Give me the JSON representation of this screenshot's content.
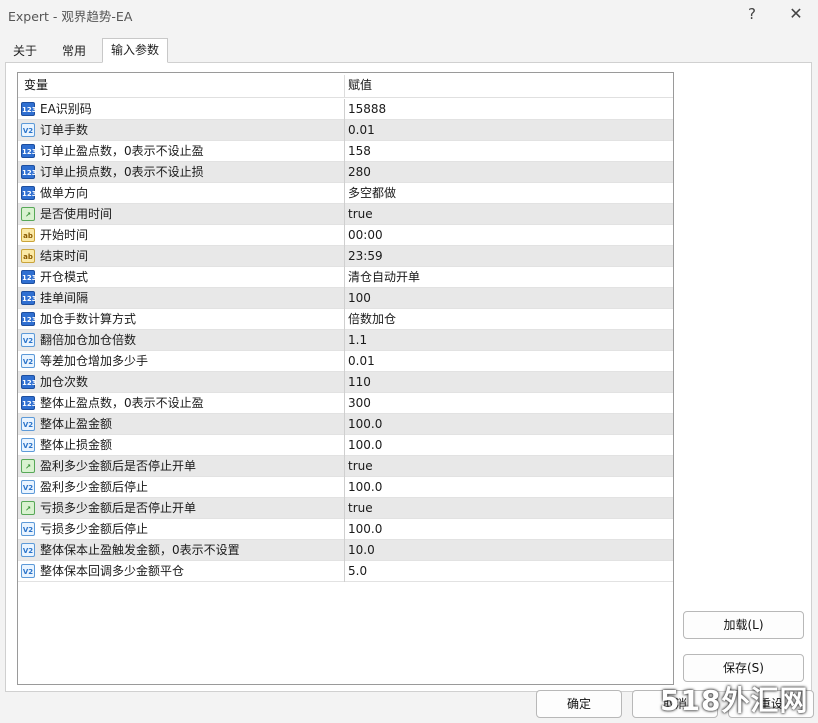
{
  "window": {
    "title": "Expert - 观界趋势-EA",
    "help": "?",
    "close": "✕"
  },
  "tabs": [
    {
      "label": "关于"
    },
    {
      "label": "常用"
    },
    {
      "label": "输入参数",
      "active": true
    }
  ],
  "grid": {
    "columns": [
      "变量",
      "赋值"
    ],
    "rows": [
      {
        "icon": "int-param-icon",
        "name": "EA识别码",
        "value": "15888"
      },
      {
        "icon": "double-param-icon",
        "name": "订单手数",
        "value": "0.01"
      },
      {
        "icon": "int-param-icon",
        "name": "订单止盈点数，0表示不设止盈",
        "value": "158"
      },
      {
        "icon": "int-param-icon",
        "name": "订单止损点数，0表示不设止损",
        "value": "280"
      },
      {
        "icon": "int-param-icon",
        "name": "做单方向",
        "value": "多空都做"
      },
      {
        "icon": "bool-param-icon",
        "name": "是否使用时间",
        "value": "true"
      },
      {
        "icon": "string-param-icon",
        "name": "开始时间",
        "value": "00:00"
      },
      {
        "icon": "string-param-icon",
        "name": "结束时间",
        "value": "23:59"
      },
      {
        "icon": "int-param-icon",
        "name": "开仓模式",
        "value": "清仓自动开单"
      },
      {
        "icon": "int-param-icon",
        "name": "挂单间隔",
        "value": "100"
      },
      {
        "icon": "int-param-icon",
        "name": "加仓手数计算方式",
        "value": "倍数加仓"
      },
      {
        "icon": "double-param-icon",
        "name": "翻倍加仓加仓倍数",
        "value": "1.1"
      },
      {
        "icon": "double-param-icon",
        "name": "等差加仓增加多少手",
        "value": "0.01"
      },
      {
        "icon": "int-param-icon",
        "name": "加仓次数",
        "value": "110"
      },
      {
        "icon": "int-param-icon",
        "name": "整体止盈点数，0表示不设止盈",
        "value": "300"
      },
      {
        "icon": "double-param-icon",
        "name": "整体止盈金额",
        "value": "100.0"
      },
      {
        "icon": "double-param-icon",
        "name": "整体止损金额",
        "value": "100.0"
      },
      {
        "icon": "bool-param-icon",
        "name": "盈利多少金额后是否停止开单",
        "value": "true"
      },
      {
        "icon": "double-param-icon",
        "name": "盈利多少金额后停止",
        "value": "100.0"
      },
      {
        "icon": "bool-param-icon",
        "name": "亏损多少金额后是否停止开单",
        "value": "true"
      },
      {
        "icon": "double-param-icon",
        "name": "亏损多少金额后停止",
        "value": "100.0"
      },
      {
        "icon": "double-param-icon",
        "name": "整体保本止盈触发金额，0表示不设置",
        "value": "10.0"
      },
      {
        "icon": "double-param-icon",
        "name": "整体保本回调多少金额平仓",
        "value": "5.0"
      }
    ]
  },
  "buttons": {
    "load": "加载(L)",
    "save": "保存(S)",
    "ok": "确定",
    "cancel": "取消",
    "reset": "重设"
  },
  "watermark": "518外汇网"
}
